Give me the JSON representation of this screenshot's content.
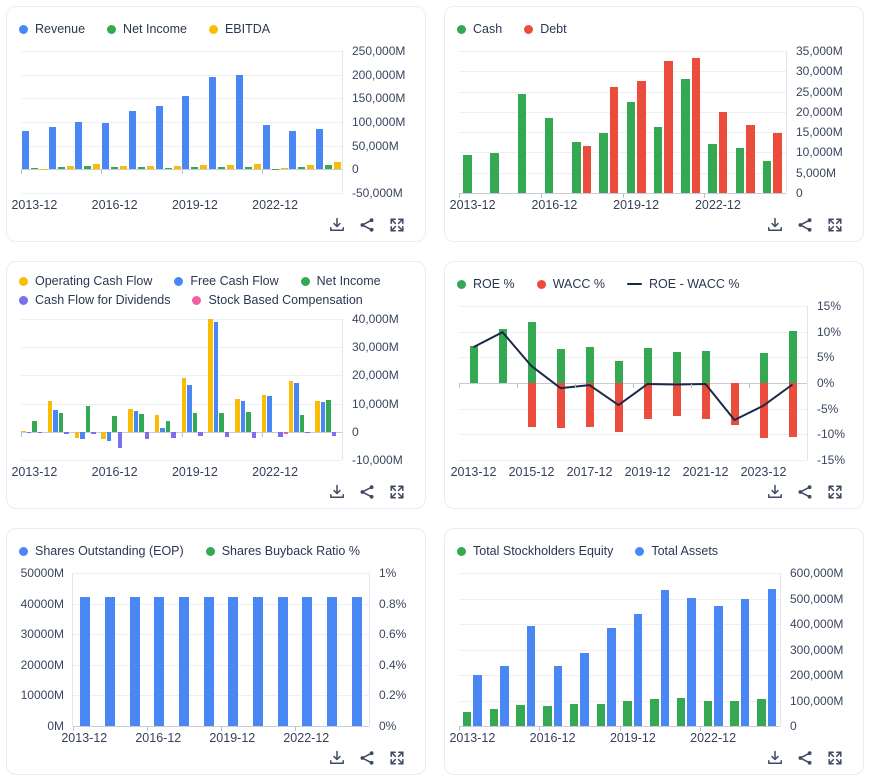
{
  "toolbar": {
    "icons": [
      {
        "name": "download-icon"
      },
      {
        "name": "share-icon"
      },
      {
        "name": "expand-icon"
      }
    ]
  },
  "colors": {
    "blue": "#4987f4",
    "green": "#34a853",
    "yellow": "#fbbc04",
    "red": "#ec4c3c",
    "purple": "#7a6ff0",
    "pink": "#f0609e",
    "navy_line": "#1b2949",
    "axis_text": "#3a4560",
    "legend_text": "#2c3652"
  },
  "chart_data": [
    {
      "name": "revenue-net-income-ebitda",
      "type": "bar",
      "categories": [
        "2013-12",
        "2014-12",
        "2015-12",
        "2016-12",
        "2017-12",
        "2018-12",
        "2019-12",
        "2020-12",
        "2021-12",
        "2022-12",
        "2023-12",
        "2024-12"
      ],
      "x_tick_label_indices": [
        0,
        3,
        6,
        9
      ],
      "y_right": {
        "min": -50000,
        "max": 250000,
        "step": 50000,
        "format": "comma_M"
      },
      "legend_position": "top-left",
      "grid": true,
      "series": [
        {
          "name": "Revenue",
          "kind": "bar",
          "color": "#4987f4",
          "values": [
            81000,
            90000,
            100000,
            99000,
            124000,
            133000,
            154000,
            196000,
            199000,
            94000,
            82000,
            86000
          ]
        },
        {
          "name": "Net Income",
          "kind": "bar",
          "color": "#34a853",
          "values": [
            3500,
            5500,
            7500,
            5000,
            5500,
            3500,
            5500,
            5500,
            6000,
            -500,
            5500,
            9500
          ]
        },
        {
          "name": "EBITDA",
          "kind": "bar",
          "color": "#fbbc04",
          "values": [
            500,
            8000,
            11000,
            7000,
            8000,
            7000,
            10000,
            10000,
            11000,
            2000,
            8500,
            15500
          ]
        }
      ]
    },
    {
      "name": "cash-debt",
      "type": "bar",
      "categories": [
        "2013-12",
        "2014-12",
        "2015-12",
        "2016-12",
        "2017-12",
        "2018-12",
        "2019-12",
        "2020-12",
        "2021-12",
        "2022-12",
        "2023-12",
        "2024-12"
      ],
      "x_tick_label_indices": [
        0,
        3,
        6,
        9
      ],
      "y_right": {
        "min": 0,
        "max": 35000,
        "step": 5000,
        "format": "comma_M"
      },
      "legend_position": "top-left",
      "grid": true,
      "series": [
        {
          "name": "Cash",
          "kind": "bar",
          "color": "#34a853",
          "values": [
            9500,
            9900,
            24300,
            18600,
            12500,
            14900,
            22400,
            16400,
            28000,
            12100,
            11200,
            7800
          ]
        },
        {
          "name": "Debt",
          "kind": "bar",
          "color": "#ec4c3c",
          "values": [
            0,
            0,
            0,
            0,
            11500,
            26200,
            27700,
            32500,
            33200,
            19900,
            16700,
            14700
          ]
        }
      ]
    },
    {
      "name": "cash-flows",
      "type": "bar",
      "categories": [
        "2013-12",
        "2014-12",
        "2015-12",
        "2016-12",
        "2017-12",
        "2018-12",
        "2019-12",
        "2020-12",
        "2021-12",
        "2022-12",
        "2023-12",
        "2024-12"
      ],
      "x_tick_label_indices": [
        0,
        3,
        6,
        9
      ],
      "y_right": {
        "min": -10000,
        "max": 40000,
        "step": 10000,
        "format": "comma_M"
      },
      "legend_position": "top-left",
      "grid": true,
      "series": [
        {
          "name": "Operating Cash Flow",
          "kind": "bar",
          "color": "#fbbc04",
          "values": [
            200,
            11000,
            -2300,
            -2700,
            8000,
            6000,
            19000,
            39900,
            11600,
            13000,
            18000,
            11000
          ]
        },
        {
          "name": "Free Cash Flow",
          "kind": "bar",
          "color": "#4987f4",
          "values": [
            100,
            7700,
            -2700,
            -3200,
            7400,
            1500,
            16500,
            39000,
            11100,
            12700,
            17400,
            10500
          ]
        },
        {
          "name": "Net Income",
          "kind": "bar",
          "color": "#34a853",
          "values": [
            4000,
            6700,
            9000,
            5600,
            6200,
            4000,
            6600,
            6700,
            7200,
            0,
            6000,
            11400
          ]
        },
        {
          "name": "Cash Flow for Dividends",
          "kind": "bar",
          "color": "#7a6ff0",
          "values": [
            -400,
            -900,
            -700,
            -5700,
            -2500,
            -2300,
            -1500,
            -2000,
            -2300,
            -1800,
            -600,
            -1500
          ]
        },
        {
          "name": "Stock Based Compensation",
          "kind": "bar",
          "color": "#f0609e",
          "values": [
            0,
            0,
            0,
            0,
            0,
            0,
            0,
            0,
            0,
            -700,
            0,
            0
          ]
        }
      ]
    },
    {
      "name": "roe-wacc",
      "type": "bar+line",
      "overlay_bars": true,
      "categories": [
        "2013-12",
        "2014-12",
        "2015-12",
        "2016-12",
        "2017-12",
        "2018-12",
        "2019-12",
        "2020-12",
        "2021-12",
        "2022-12",
        "2023-12",
        "2024-12"
      ],
      "x_tick_label_indices": [
        0,
        2,
        4,
        6,
        8,
        10
      ],
      "y_right": {
        "min": -15,
        "max": 15,
        "step": 5,
        "format": "percent"
      },
      "legend_position": "top-left",
      "grid": true,
      "series": [
        {
          "name": "ROE %",
          "kind": "bar",
          "color": "#34a853",
          "values": [
            7.3,
            10.6,
            11.8,
            6.7,
            7.1,
            4.3,
            6.9,
            6.1,
            6.2,
            -0.5,
            5.8,
            10.2
          ]
        },
        {
          "name": "WACC %",
          "kind": "bar",
          "color": "#ec4c3c",
          "values": [
            0,
            0,
            -8.5,
            -8.7,
            -8.5,
            -9.6,
            -7.1,
            -6.5,
            -7.0,
            -8.2,
            -10.8,
            -10.5
          ]
        },
        {
          "name": "ROE - WACC %",
          "kind": "line",
          "color": "#1b2949",
          "values": [
            7.0,
            9.9,
            3.3,
            -1.0,
            -0.4,
            -4.3,
            -0.2,
            -0.3,
            -0.2,
            -7.2,
            -4.4,
            -0.3
          ]
        }
      ]
    },
    {
      "name": "shares-outstanding-buyback",
      "type": "bar",
      "categories": [
        "2013-12",
        "2014-12",
        "2015-12",
        "2016-12",
        "2017-12",
        "2018-12",
        "2019-12",
        "2020-12",
        "2021-12",
        "2022-12",
        "2023-12",
        "2024-12"
      ],
      "x_tick_label_indices": [
        0,
        3,
        6,
        9
      ],
      "y_left": {
        "min": 0,
        "max": 50000,
        "step": 10000,
        "format": "plain_M"
      },
      "y_right": {
        "min": 0,
        "max": 1,
        "step": 0.2,
        "format": "percent"
      },
      "legend_position": "top-left",
      "grid": true,
      "series": [
        {
          "name": "Shares Outstanding (EOP)",
          "kind": "bar",
          "axis": "left",
          "color": "#4987f4",
          "values": [
            42300,
            42300,
            42300,
            42300,
            42300,
            42300,
            42300,
            42300,
            42300,
            42300,
            42300,
            42300
          ]
        },
        {
          "name": "Shares Buyback Ratio %",
          "kind": "bar",
          "axis": "right",
          "color": "#34a853",
          "values": [
            0,
            0,
            0,
            0,
            0,
            0,
            0,
            0,
            0,
            0,
            0,
            0
          ]
        }
      ]
    },
    {
      "name": "equity-assets",
      "type": "bar",
      "categories": [
        "2013-12",
        "2014-12",
        "2015-12",
        "2016-12",
        "2017-12",
        "2018-12",
        "2019-12",
        "2020-12",
        "2021-12",
        "2022-12",
        "2023-12",
        "2024-12"
      ],
      "x_tick_label_indices": [
        0,
        3,
        6,
        9
      ],
      "y_right": {
        "min": 0,
        "max": 600000,
        "step": 100000,
        "format": "comma_M"
      },
      "legend_position": "top-left",
      "grid": true,
      "series": [
        {
          "name": "Total Stockholders Equity",
          "kind": "bar",
          "color": "#34a853",
          "values": [
            56000,
            68000,
            83000,
            77000,
            87000,
            88000,
            97000,
            108000,
            109000,
            98000,
            100000,
            107000
          ]
        },
        {
          "name": "Total Assets",
          "kind": "bar",
          "color": "#4987f4",
          "values": [
            200000,
            236000,
            392000,
            236000,
            286000,
            384000,
            439000,
            534000,
            504000,
            470000,
            499000,
            539000
          ]
        }
      ]
    }
  ]
}
